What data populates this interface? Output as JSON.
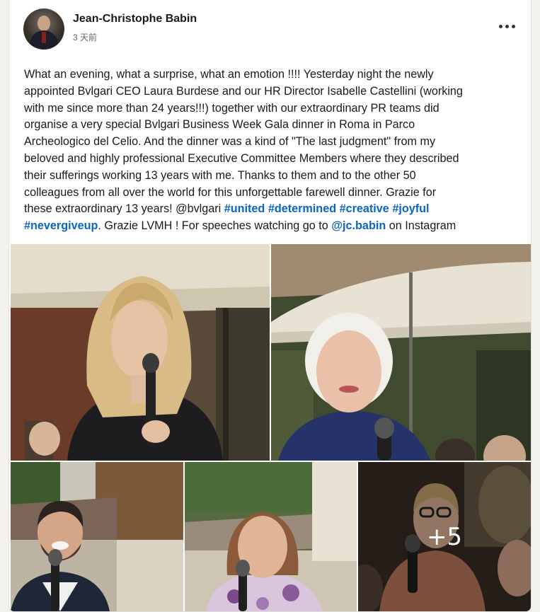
{
  "post": {
    "author": {
      "name": "Jean-Christophe Babin",
      "time": "3 天前",
      "avatar_icon": "profile-photo"
    },
    "more_icon": "more-horizontal-icon",
    "text": {
      "line1": "What an evening, what a surprise, what an emotion !!!! Yesterday night the newly",
      "line2": "appointed Bvlgari CEO Laura Burdese and our HR Director Isabelle Castellini (working",
      "line3": "with me since more than 24 years!!!) together with our extraordinary PR teams did",
      "line4": "organise a very special Bvlgari Business Week Gala dinner in Roma in Parco",
      "line5": "Archeologico del Celio. And the dinner was a kind of \"The last judgment\" from my",
      "line6": "beloved and highly professional Executive Committee Members where they described",
      "line7": "their sufferings working 13 years with me. Thanks to them and to the other 50",
      "line8": "colleagues from all over the world for this unforgettable farewell dinner.  Grazie for",
      "line9_start": "these extraordinary 13 years! @bvlgari ",
      "hashtag_united": "#united",
      "hashtag_determined": "#determined",
      "hashtag_creative": "#creative",
      "hashtag_joyful": "#joyful",
      "hashtag_nevergiveup": "#nevergiveup",
      "line10_mid": ". Grazie LVMH ! For speeches watching go to ",
      "mention_jcbabin": "@jc.babin",
      "line10_end": " on Instagram"
    },
    "photos": {
      "count_more": "+5",
      "colors": {
        "umbrella": "#e6e0d3",
        "foliage": "#3d4a2b",
        "dark": "#2b2622"
      }
    }
  }
}
